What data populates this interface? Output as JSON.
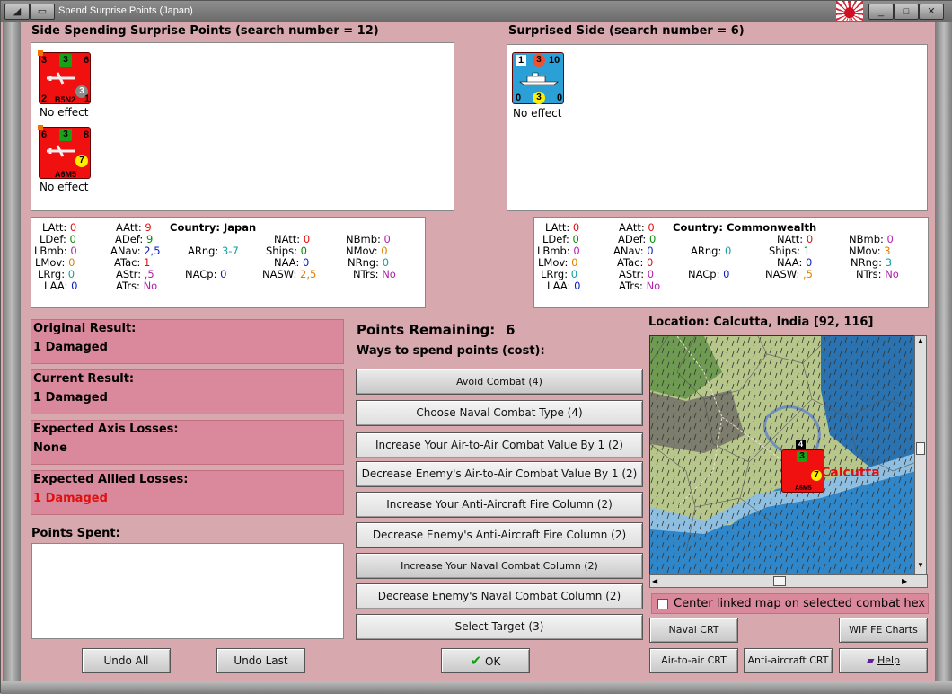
{
  "window": {
    "title": "Spend Surprise Points (Japan)"
  },
  "left_side": {
    "header": "Side Spending Surprise Points (search number = 12)",
    "units": [
      {
        "name": "B5N2",
        "top_left": "3",
        "top_center": "3",
        "top_right": "6",
        "right_dot": "3",
        "bottom_left": "2",
        "bottom_right": "1",
        "status": "No effect"
      },
      {
        "name": "A6M5",
        "top_left": "6",
        "top_center": "3",
        "top_right": "8",
        "right_dot": "7",
        "bottom_left": "1",
        "bottom_right": "1",
        "status": "No effect"
      }
    ]
  },
  "right_side": {
    "header": "Surprised Side (search number = 6)",
    "units": [
      {
        "top_left": "1",
        "top_center": "3",
        "top_right": "10",
        "bottom_left": "0",
        "bottom_center": "3",
        "bottom_right": "0",
        "status": "No effect"
      }
    ]
  },
  "stats_left": {
    "country_label": "Country: Japan",
    "rows": [
      [
        [
          "LAtt:",
          "0",
          "v0"
        ],
        [
          "AAtt:",
          "9",
          "v0"
        ],
        [
          "NAtt:",
          "0",
          "v0"
        ],
        [
          "NBmb:",
          "0",
          "vp"
        ]
      ],
      [
        [
          "LDef:",
          "0",
          "vg"
        ],
        [
          "ADef:",
          "9",
          "vg"
        ],
        [
          "Ships:",
          "0",
          "vg"
        ],
        [
          "NMov:",
          "0",
          "vo"
        ]
      ],
      [
        [
          "LBmb:",
          "0",
          "vp"
        ],
        [
          "ANav:",
          "2,5",
          "vb"
        ],
        [
          "ARng:",
          "3-7",
          "vt"
        ],
        [
          "NAA:",
          "0",
          "vb"
        ],
        [
          "NRng:",
          "0",
          "vt"
        ]
      ],
      [
        [
          "LMov:",
          "0",
          "vo"
        ],
        [
          "ATac:",
          "1",
          "v0"
        ],
        [
          "NACp:",
          "0",
          "vb"
        ],
        [
          "NASW:",
          "2,5",
          "vo"
        ],
        [
          "NTrs:",
          "No",
          "vp"
        ]
      ],
      [
        [
          "LRrg:",
          "0",
          "vt"
        ],
        [
          "AStr:",
          ",5",
          "vp"
        ]
      ],
      [
        [
          "LAA:",
          "0",
          "vb"
        ],
        [
          "ATrs:",
          "No",
          "vp"
        ]
      ]
    ]
  },
  "stats_right": {
    "country_label": "Country: Commonwealth",
    "rows": [
      [
        [
          "LAtt:",
          "0",
          "v0"
        ],
        [
          "AAtt:",
          "0",
          "v0"
        ],
        [
          "NAtt:",
          "0",
          "v0"
        ],
        [
          "NBmb:",
          "0",
          "vp"
        ]
      ],
      [
        [
          "LDef:",
          "0",
          "vg"
        ],
        [
          "ADef:",
          "0",
          "vg"
        ],
        [
          "Ships:",
          "1",
          "vg"
        ],
        [
          "NMov:",
          "3",
          "vo"
        ]
      ],
      [
        [
          "LBmb:",
          "0",
          "vp"
        ],
        [
          "ANav:",
          "0",
          "vb"
        ],
        [
          "ARng:",
          "0",
          "vt"
        ],
        [
          "NAA:",
          "0",
          "vb"
        ],
        [
          "NRng:",
          "3",
          "vt"
        ]
      ],
      [
        [
          "LMov:",
          "0",
          "vo"
        ],
        [
          "ATac:",
          "0",
          "v0"
        ],
        [
          "NACp:",
          "0",
          "vb"
        ],
        [
          "NASW:",
          ",5",
          "vo"
        ],
        [
          "NTrs:",
          "No",
          "vp"
        ]
      ],
      [
        [
          "LRrg:",
          "0",
          "vt"
        ],
        [
          "AStr:",
          "0",
          "vp"
        ]
      ],
      [
        [
          "LAA:",
          "0",
          "vb"
        ],
        [
          "ATrs:",
          "No",
          "vp"
        ]
      ]
    ]
  },
  "results": {
    "original_label": "Original Result:",
    "original_value": "1 Damaged",
    "current_label": "Current Result:",
    "current_value": "1 Damaged",
    "axis_label": "Expected Axis Losses:",
    "axis_value": "None",
    "allied_label": "Expected Allied Losses:",
    "allied_value": "1 Damaged",
    "points_spent_label": "Points Spent:"
  },
  "spend": {
    "points_label": "Points Remaining:",
    "points_value": "6",
    "ways_label": "Ways to spend points (cost):",
    "options": [
      "Avoid Combat (4)",
      "Choose Naval Combat Type (4)",
      "Increase Your Air-to-Air Combat Value By 1 (2)",
      "Decrease Enemy's Air-to-Air Combat Value By 1 (2)",
      "Increase Your Anti-Aircraft Fire Column (2)",
      "Decrease Enemy's Anti-Aircraft Fire Column (2)",
      "Increase Your Naval Combat Column (2)",
      "Decrease Enemy's Naval Combat Column (2)",
      "Select Target (3)"
    ]
  },
  "map": {
    "location": "Location: Calcutta, India [92, 116]",
    "city_label": "Calcutta",
    "stack_count": "4",
    "unit_name": "A6M5",
    "center_linked_label": "Center linked map on selected combat hex"
  },
  "buttons": {
    "undo_all": "Undo All",
    "undo_last": "Undo Last",
    "ok": "OK",
    "naval_crt": "Naval CRT",
    "wif_charts": "WIF FE Charts",
    "air_crt": "Air-to-air CRT",
    "aa_crt": "Anti-aircraft CRT",
    "help": "Help"
  },
  "colors": {
    "background": "#d7a8ad",
    "result_box": "#d9899b",
    "japan_counter": "#f01010",
    "cw_counter": "#2aa0d6",
    "alert_text": "#e01010"
  }
}
